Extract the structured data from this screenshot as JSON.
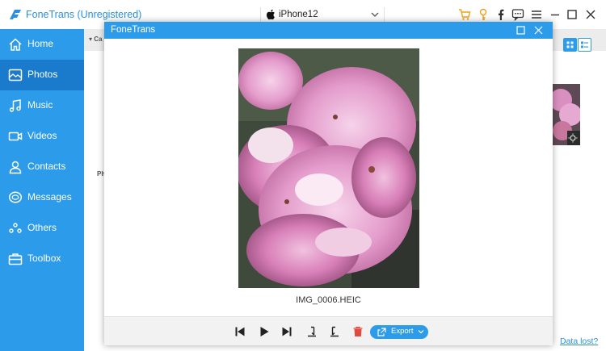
{
  "app": {
    "title": "FoneTrans (Unregistered)"
  },
  "device": {
    "name": "iPhone12"
  },
  "titlebar_icons": [
    "cart-icon",
    "key-icon",
    "facebook-icon",
    "chat-icon",
    "menu-icon",
    "minimize-icon",
    "maximize-icon",
    "close-icon"
  ],
  "sidebar": {
    "items": [
      {
        "label": "Home",
        "icon": "home-icon",
        "active": false
      },
      {
        "label": "Photos",
        "icon": "photo-icon",
        "active": true
      },
      {
        "label": "Music",
        "icon": "music-icon",
        "active": false
      },
      {
        "label": "Videos",
        "icon": "video-icon",
        "active": false
      },
      {
        "label": "Contacts",
        "icon": "contacts-icon",
        "active": false
      },
      {
        "label": "Messages",
        "icon": "messages-icon",
        "active": false
      },
      {
        "label": "Others",
        "icon": "others-icon",
        "active": false
      },
      {
        "label": "Toolbox",
        "icon": "toolbox-icon",
        "active": false
      }
    ]
  },
  "background": {
    "category_header": "Ca",
    "photo_group_label": "Ph",
    "data_lost_link": "Data lost?"
  },
  "preview": {
    "title": "FoneTrans",
    "file_name": "IMG_0006.HEIC",
    "export_label": "Export",
    "toolbar_icons": [
      "first-icon",
      "play-icon",
      "last-icon",
      "rotate-left-icon",
      "rotate-right-icon",
      "delete-icon",
      "export-icon"
    ]
  },
  "colors": {
    "accent": "#2c9bea",
    "sidebar_active": "#1a7bcc",
    "delete": "#e04a3f"
  }
}
